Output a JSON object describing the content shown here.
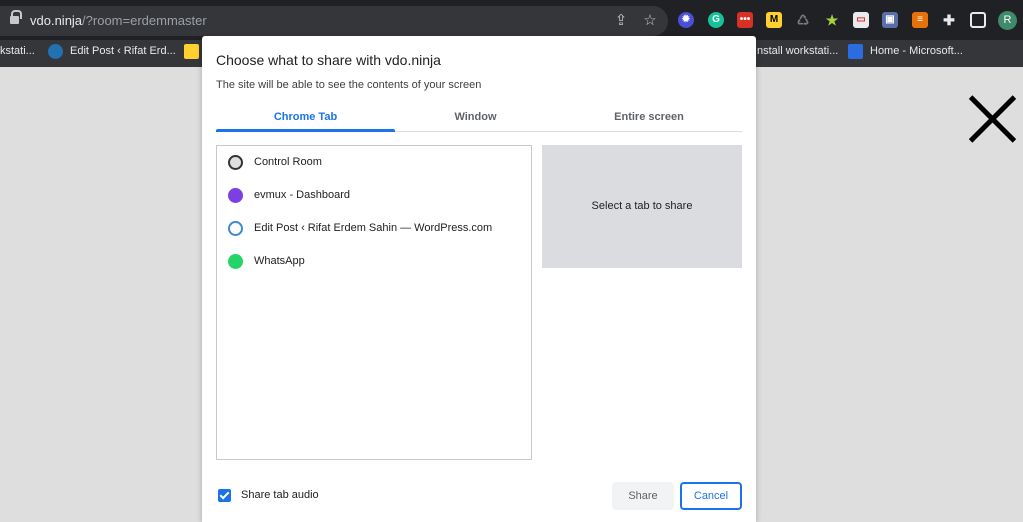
{
  "browser": {
    "url_host": "vdo.ninja",
    "url_path": "/?room=erdemmaster",
    "avatar_letter": "R",
    "bookmarks": [
      {
        "label": "kstati..."
      },
      {
        "label": "Edit Post ‹ Rifat Erd..."
      },
      {
        "label": "nstall workstati..."
      },
      {
        "label": "Home - Microsoft..."
      }
    ]
  },
  "dialog": {
    "title": "Choose what to share with vdo.ninja",
    "subtitle": "The site will be able to see the contents of your screen",
    "tabs": [
      {
        "label": "Chrome Tab",
        "active": true
      },
      {
        "label": "Window",
        "active": false
      },
      {
        "label": "Entire screen",
        "active": false
      }
    ],
    "items": [
      {
        "label": "Control Room",
        "icon": "control-room-icon"
      },
      {
        "label": "evmux - Dashboard",
        "icon": "evmux-icon"
      },
      {
        "label": "Edit Post ‹ Rifat Erdem Sahin — WordPress.com",
        "icon": "wordpress-icon"
      },
      {
        "label": "WhatsApp",
        "icon": "whatsapp-icon"
      }
    ],
    "preview_text": "Select a tab to share",
    "audio_label": "Share tab audio",
    "audio_checked": true,
    "share_label": "Share",
    "cancel_label": "Cancel"
  },
  "colors": {
    "accent": "#1a73e8",
    "chrome_bg": "#202124",
    "page_bg": "#dedede"
  }
}
